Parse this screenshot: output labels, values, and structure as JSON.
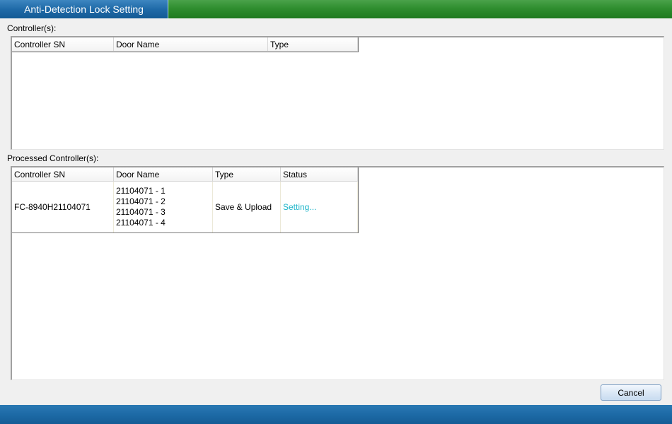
{
  "window": {
    "title": "Anti-Detection Lock Setting"
  },
  "controllers_section": {
    "label": "Controller(s):",
    "columns": [
      "Controller SN",
      "Door Name",
      "Type"
    ],
    "rows": []
  },
  "processed_section": {
    "label": "Processed Controller(s):",
    "columns": [
      "Controller SN",
      "Door Name",
      "Type",
      "Status"
    ],
    "rows": [
      {
        "controller_sn": "FC-8940H21104071",
        "doors": [
          "21104071 - 1",
          "21104071 - 2",
          "21104071 - 3",
          "21104071 - 4"
        ],
        "type": "Save & Upload",
        "status": "Setting..."
      }
    ]
  },
  "buttons": {
    "cancel": "Cancel"
  },
  "colors": {
    "title_tab": "#1f6aa8",
    "title_bar": "#2f8e2f",
    "status_text": "#1cb5c9",
    "bottom_bar": "#1d6aa6"
  }
}
